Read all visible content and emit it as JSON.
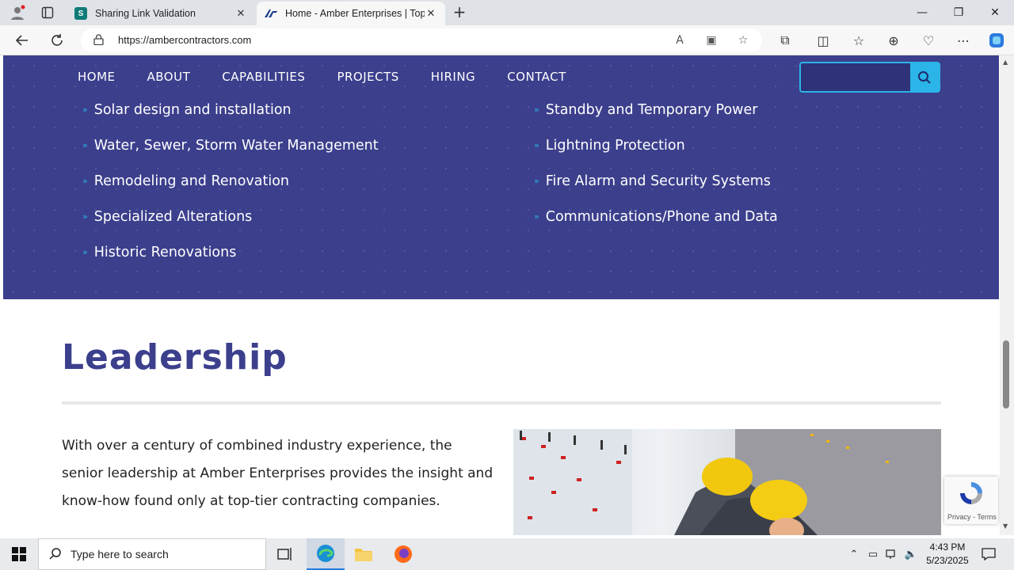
{
  "browser": {
    "tabs": [
      {
        "title": "Sharing Link Validation",
        "favicon": "sharepoint-icon",
        "active": false
      },
      {
        "title": "Home - Amber Enterprises | Top-",
        "favicon": "amber-logo-icon",
        "active": true
      }
    ],
    "url": "https://ambercontractors.com"
  },
  "site": {
    "nav": [
      "HOME",
      "ABOUT",
      "CAPABILITIES",
      "PROJECTS",
      "HIRING",
      "CONTACT"
    ],
    "search_placeholder": "",
    "services_left": [
      "Solar design and installation",
      "Water, Sewer, Storm Water Management",
      "Remodeling and Renovation",
      "Specialized Alterations",
      "Historic Renovations"
    ],
    "services_right": [
      "Standby and Temporary Power",
      "Lightning Protection",
      "Fire Alarm and Security Systems",
      "Communications/Phone and Data"
    ],
    "leadership_title": "Leadership",
    "leadership_text": "With over a century of combined industry experience, the senior leadership at Amber Enterprises provides the insight and know-how found only at top-tier contracting companies.",
    "recaptcha_text": "Privacy - Terms",
    "colors": {
      "primary": "#3b3f8c",
      "accent": "#2bb4e8"
    }
  },
  "taskbar": {
    "search_placeholder": "Type here to search",
    "time": "4:43 PM",
    "date": "5/23/2025"
  }
}
